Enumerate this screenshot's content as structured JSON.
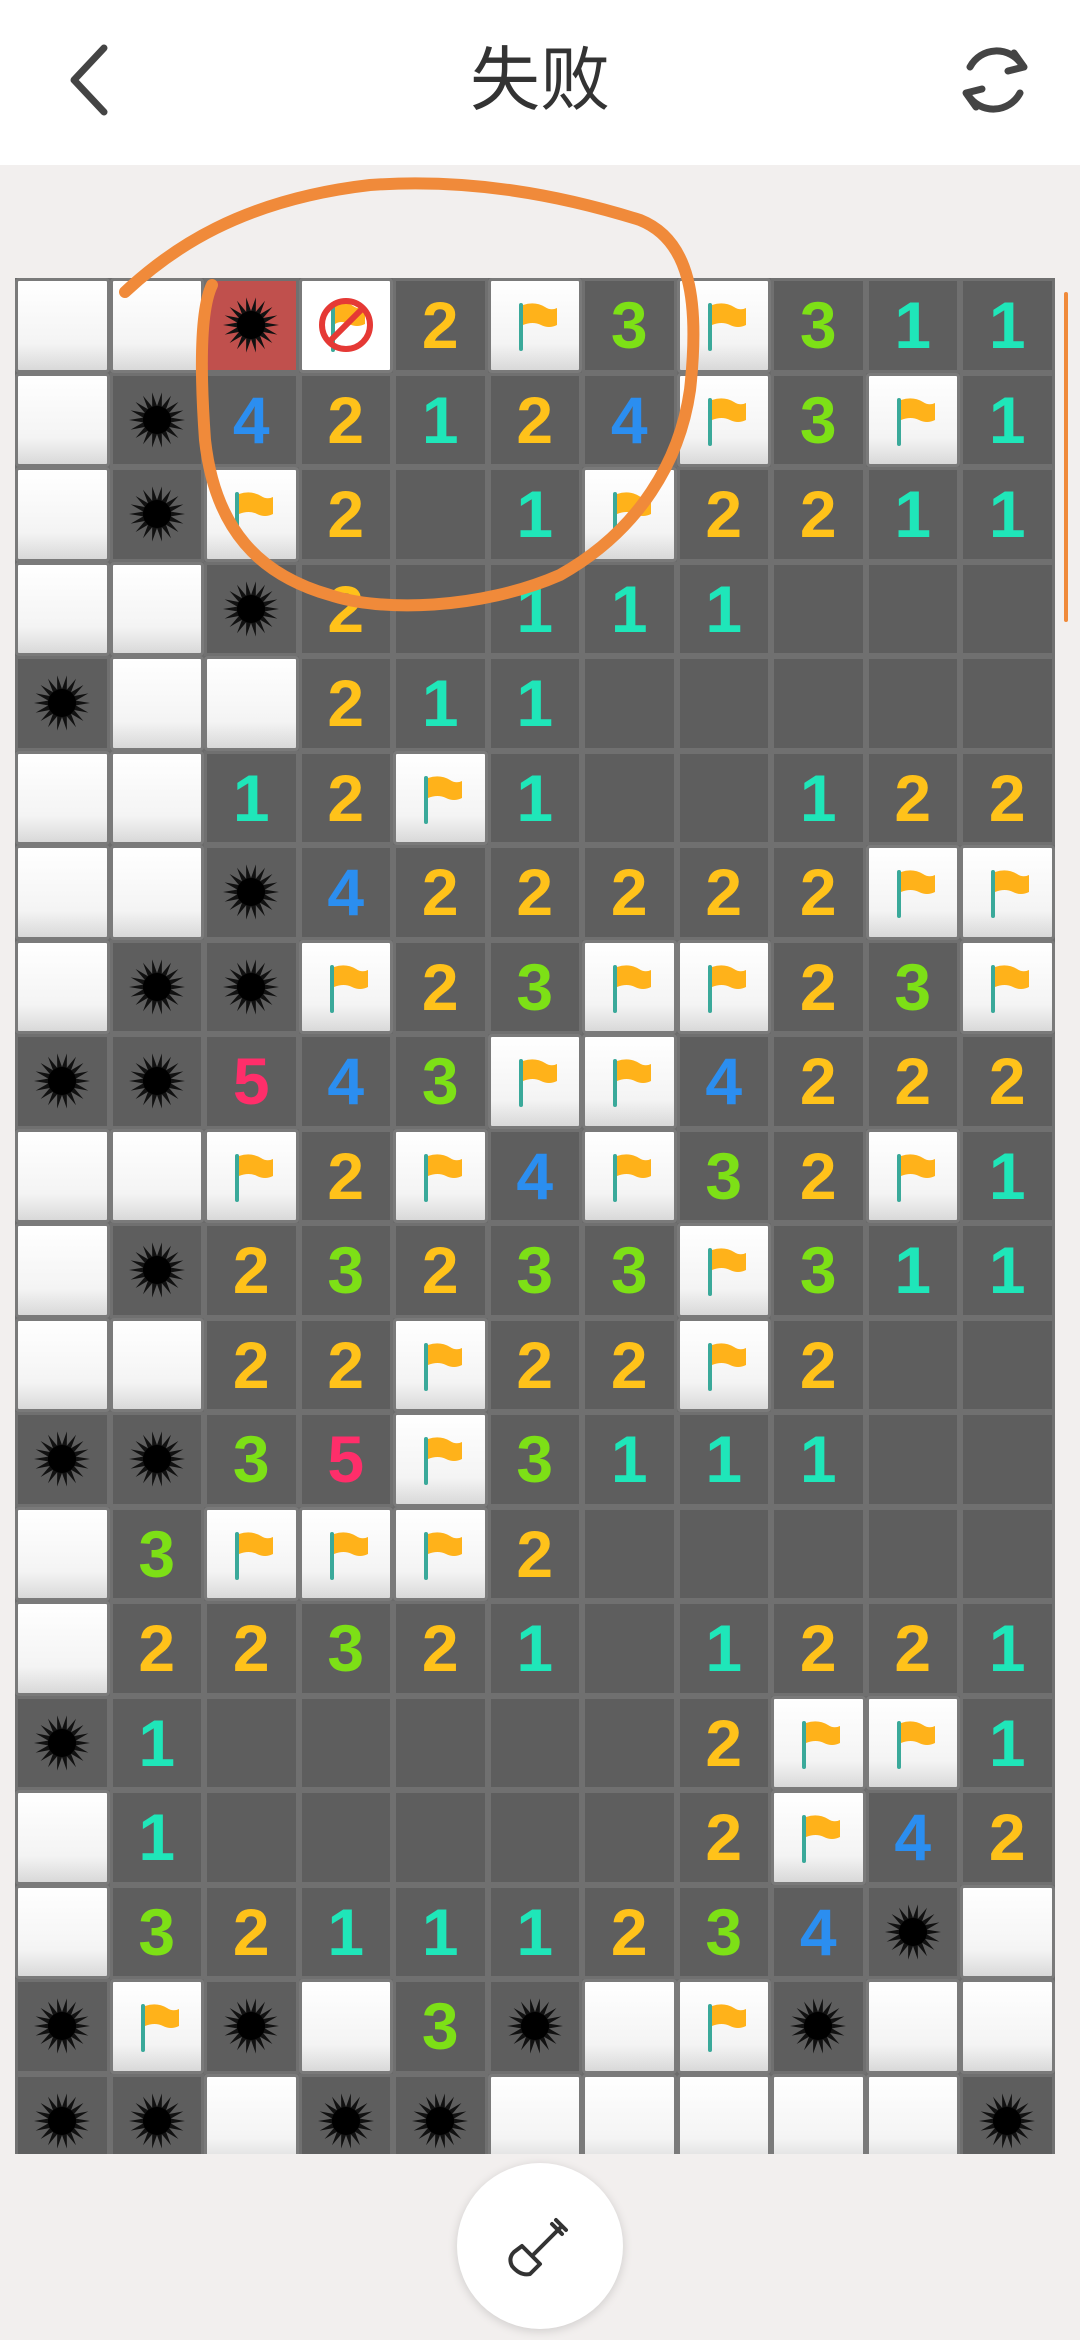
{
  "header": {
    "title": "失败",
    "back_icon": "chevron-left-icon",
    "restart_icon": "refresh-icon"
  },
  "board": {
    "rows": 20,
    "cols": 11,
    "legend": {
      "W": "hidden",
      ".": "revealed-empty",
      "M": "mine",
      "X": "exploded-mine",
      "F": "flag",
      "N": "wrong-flag",
      "1-8": "number"
    },
    "grid": [
      [
        "W",
        "W",
        "X",
        "N",
        "2",
        "F",
        "3",
        "F",
        "3",
        "1",
        "1"
      ],
      [
        "W",
        "M",
        "4",
        "2",
        "1",
        "2",
        "4",
        "F",
        "3",
        "F",
        "1"
      ],
      [
        "W",
        "M",
        "F",
        "2",
        ".",
        "1",
        "F",
        "2",
        "2",
        "1",
        "1"
      ],
      [
        "W",
        "W",
        "M",
        "2",
        ".",
        "1",
        "1",
        "1",
        ".",
        ".",
        "."
      ],
      [
        "M",
        "W",
        "W",
        "2",
        "1",
        "1",
        ".",
        ".",
        ".",
        ".",
        "."
      ],
      [
        "W",
        "W",
        "1",
        "2",
        "F",
        "1",
        ".",
        ".",
        "1",
        "2",
        "2"
      ],
      [
        "W",
        "W",
        "M",
        "4",
        "2",
        "2",
        "2",
        "2",
        "2",
        "F",
        "F"
      ],
      [
        "W",
        "M",
        "M",
        "F",
        "2",
        "3",
        "F",
        "F",
        "2",
        "3",
        "F"
      ],
      [
        "M",
        "M",
        "5",
        "4",
        "3",
        "F",
        "F",
        "4",
        "2",
        "2",
        "2"
      ],
      [
        "W",
        "W",
        "F",
        "2",
        "F",
        "4",
        "F",
        "3",
        "2",
        "F",
        "1"
      ],
      [
        "W",
        "M",
        "2",
        "3",
        "2",
        "3",
        "3",
        "F",
        "3",
        "1",
        "1"
      ],
      [
        "W",
        "W",
        "2",
        "2",
        "F",
        "2",
        "2",
        "F",
        "2",
        ".",
        "."
      ],
      [
        "M",
        "M",
        "3",
        "5",
        "F",
        "3",
        "1",
        "1",
        "1",
        ".",
        "."
      ],
      [
        "W",
        "3",
        "F",
        "F",
        "F",
        "2",
        ".",
        ".",
        ".",
        ".",
        "."
      ],
      [
        "W",
        "2",
        "2",
        "3",
        "2",
        "1",
        ".",
        "1",
        "2",
        "2",
        "1"
      ],
      [
        "M",
        "1",
        ".",
        ".",
        ".",
        ".",
        ".",
        "2",
        "F",
        "F",
        "1"
      ],
      [
        "W",
        "1",
        ".",
        ".",
        ".",
        ".",
        ".",
        "2",
        "F",
        "4",
        "2"
      ],
      [
        "W",
        "3",
        "2",
        "1",
        "1",
        "1",
        "2",
        "3",
        "4",
        "M",
        "W"
      ],
      [
        "M",
        "F",
        "M",
        "W",
        "3",
        "M",
        "W",
        "F",
        "M",
        "W",
        "W"
      ],
      [
        "M",
        "M",
        "W",
        "M",
        "M",
        "W",
        "W",
        "W",
        "W",
        "W",
        "M"
      ]
    ]
  },
  "colors": {
    "annotation_stroke": "#f08a3a",
    "n1": "#1fe6b9",
    "n2": "#ffc21a",
    "n3": "#7de016",
    "n4": "#2b8ef0",
    "n5": "#ff2e6a",
    "exploded": "#c0504d"
  },
  "footer": {
    "dig_icon": "shovel-icon"
  }
}
